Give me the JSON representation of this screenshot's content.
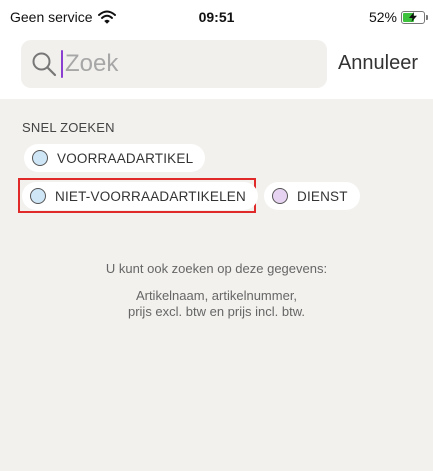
{
  "status_bar": {
    "carrier": "Geen service",
    "time": "09:51",
    "battery": "52%"
  },
  "search": {
    "placeholder": "Zoek",
    "cancel_label": "Annuleer"
  },
  "quick_search": {
    "title": "SNEL ZOEKEN",
    "chips": [
      {
        "label": "VOORRAADARTIKEL",
        "color": "#cfe6f7"
      },
      {
        "label": "NIET-VOORRAADARTIKELEN",
        "color": "#cfe6f7"
      },
      {
        "label": "DIENST",
        "color": "#e6d3f1"
      }
    ]
  },
  "info": {
    "line1": "U kunt ook zoeken op deze gegevens:",
    "line2": "Artikelnaam, artikelnummer,",
    "line3": "prijs excl. btw en prijs incl. btw."
  },
  "colors": {
    "highlight": "#e02a2a",
    "caret": "#8a3fd1",
    "battery_fill": "#3ec23e"
  }
}
